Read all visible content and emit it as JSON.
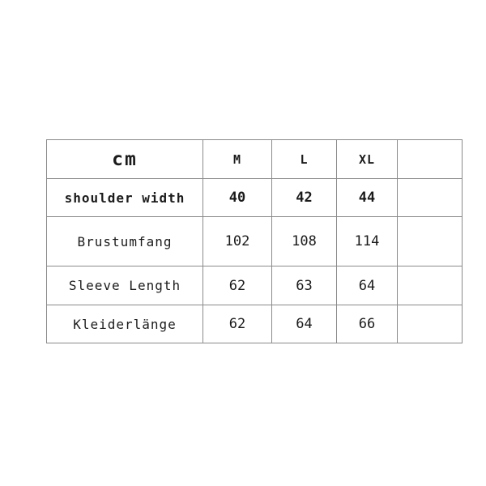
{
  "chart_data": {
    "type": "table",
    "title": "",
    "unit_label": "cm",
    "columns": [
      "cm",
      "M",
      "L",
      "XL",
      ""
    ],
    "size_columns": [
      "M",
      "L",
      "XL"
    ],
    "rows": [
      {
        "label": "shoulder width",
        "values": [
          "40",
          "42",
          "44",
          ""
        ],
        "emphasis": "bold"
      },
      {
        "label": "Brustumfang",
        "values": [
          "102",
          "108",
          "114",
          ""
        ],
        "emphasis": "normal"
      },
      {
        "label": "Sleeve Length",
        "values": [
          "62",
          "63",
          "64",
          ""
        ],
        "emphasis": "normal"
      },
      {
        "label": "Kleiderlänge",
        "values": [
          "62",
          "64",
          "66",
          ""
        ],
        "emphasis": "normal"
      }
    ],
    "grid": true,
    "legend": "none"
  },
  "table": {
    "header": {
      "unit": "cm",
      "size_m": "M",
      "size_l": "L",
      "size_xl": "XL",
      "blank": ""
    },
    "rows": [
      {
        "label": "shoulder width",
        "m": "40",
        "l": "42",
        "xl": "44",
        "blank": ""
      },
      {
        "label": "Brustumfang",
        "m": "102",
        "l": "108",
        "xl": "114",
        "blank": ""
      },
      {
        "label": "Sleeve Length",
        "m": "62",
        "l": "63",
        "xl": "64",
        "blank": ""
      },
      {
        "label": "Kleiderlänge",
        "m": "62",
        "l": "64",
        "xl": "66",
        "blank": ""
      }
    ]
  },
  "colors": {
    "background": "#ffffff",
    "text": "#1b1b1b",
    "border": "#8a8a8a",
    "header_rule": "#c9c9c9"
  }
}
